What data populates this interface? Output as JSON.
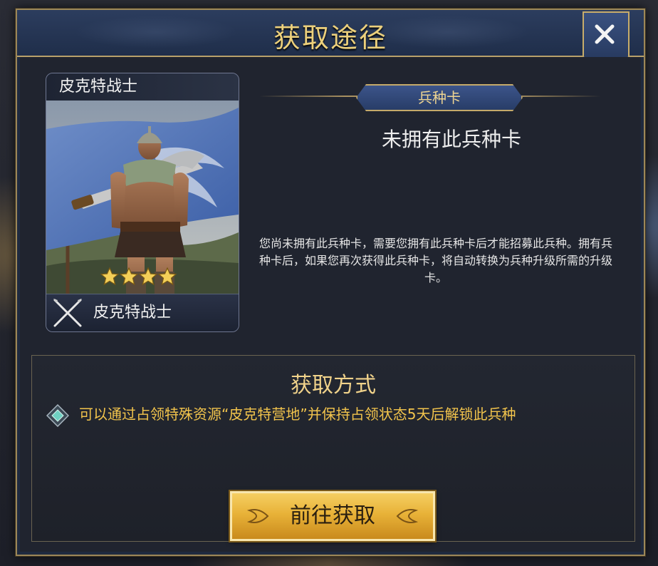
{
  "dialog": {
    "title": "获取途径",
    "close_icon": "close-icon"
  },
  "unit_card": {
    "name_top": "皮克特战士",
    "name_bottom": "皮克特战士",
    "stars": 4,
    "type_icon": "crossed-swords-icon"
  },
  "info": {
    "tag": "兵种卡",
    "status": "未拥有此兵种卡",
    "description": "您尚未拥有此兵种卡，需要您拥有此兵种卡后才能招募此兵种。拥有兵种卡后，如果您再次获得此兵种卡，将自动转换为兵种升级所需的升级卡。"
  },
  "method": {
    "title": "获取方式",
    "items": [
      {
        "icon": "diamond-gem-icon",
        "text": "可以通过占领特殊资源“皮克特营地”并保持占领状态5天后解锁此兵种"
      }
    ],
    "button_label": "前往获取"
  },
  "colors": {
    "gold_text": "#f2c44c",
    "title_gold": "#ecd07c",
    "button_gold": "#e8b238",
    "panel_bg": "#20242f",
    "header_blue": "#2c3d5e"
  }
}
